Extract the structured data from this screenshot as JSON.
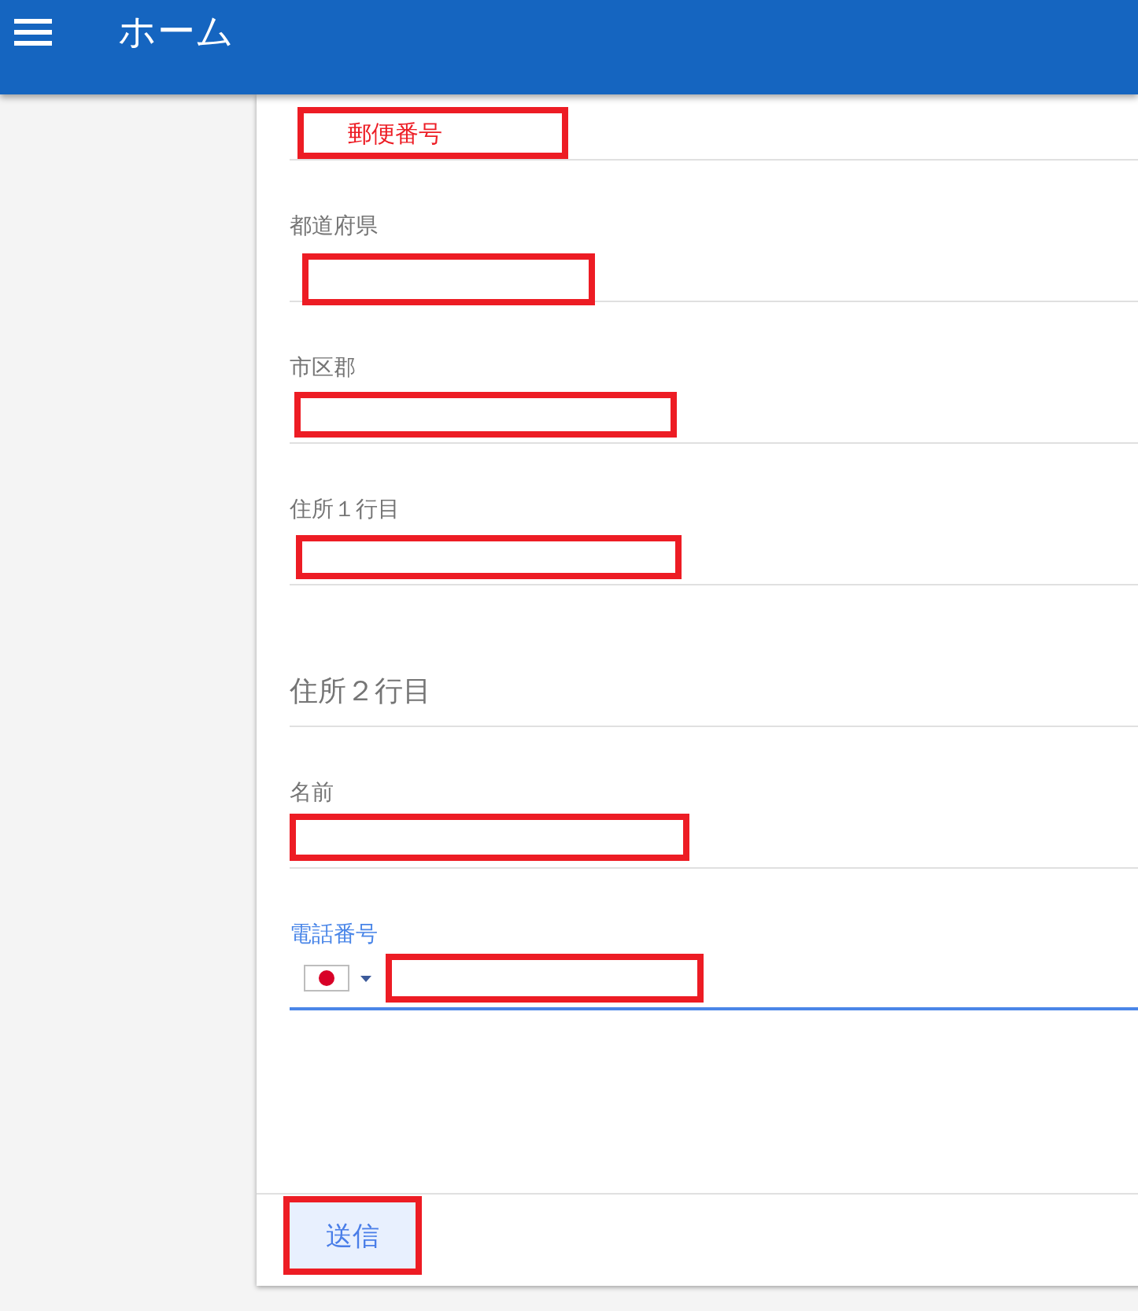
{
  "app_bar": {
    "title": "ホーム"
  },
  "form": {
    "fields": [
      {
        "kind": "text",
        "highlighted": true,
        "highlight_text": "郵便番号",
        "focused": false
      },
      {
        "kind": "text",
        "label": "都道府県",
        "highlighted": true,
        "focused": false
      },
      {
        "kind": "text",
        "label": "市区郡",
        "highlighted": true,
        "focused": false
      },
      {
        "kind": "text",
        "label": "住所１行目",
        "highlighted": true,
        "focused": false
      },
      {
        "kind": "text",
        "placeholder": "住所２行目",
        "highlighted": false,
        "focused": false
      },
      {
        "kind": "text",
        "label": "名前",
        "highlighted": true,
        "focused": false
      },
      {
        "kind": "phone",
        "label": "電話番号",
        "highlighted": true,
        "focused": true
      }
    ],
    "submit": {
      "label": "送信",
      "highlighted": true
    }
  }
}
